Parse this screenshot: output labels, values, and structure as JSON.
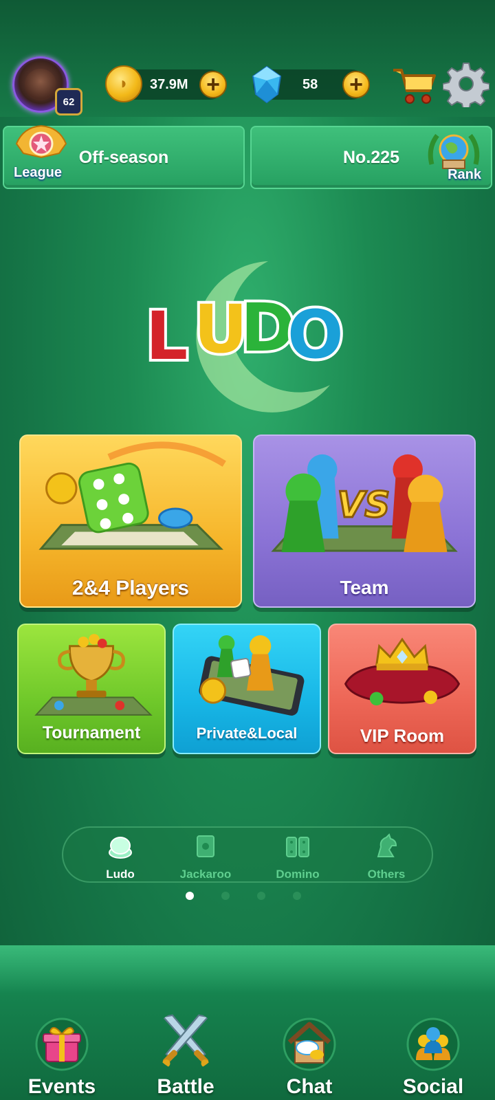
{
  "player": {
    "level": "62"
  },
  "currency": {
    "coins": "37.9M",
    "gems": "58",
    "add_symbol": "+"
  },
  "league": {
    "label": "League",
    "status": "Off-season"
  },
  "rank": {
    "label": "Rank",
    "position": "No.225"
  },
  "logo": {
    "letters": [
      "L",
      "U",
      "D",
      "O"
    ],
    "letter_colors": [
      "#d4232a",
      "#f3c21a",
      "#2bb33a",
      "#1aa0d8"
    ]
  },
  "modes": {
    "players": "2&4 Players",
    "team": "Team",
    "tournament": "Tournament",
    "private": "Private&Local",
    "vip": "VIP Room"
  },
  "game_tabs": [
    {
      "label": "Ludo",
      "active": true
    },
    {
      "label": "Jackaroo",
      "active": false
    },
    {
      "label": "Domino",
      "active": false
    },
    {
      "label": "Others",
      "active": false
    }
  ],
  "page_indicator": {
    "count": 4,
    "active_index": 0
  },
  "bottom_nav": {
    "events": "Events",
    "battle": "Battle",
    "chat": "Chat",
    "social": "Social",
    "active": "Battle"
  },
  "icons": {
    "cart": "shopping-cart-icon",
    "settings": "gear-icon",
    "coin": "coin-icon",
    "gem": "gem-icon"
  },
  "colors": {
    "background": "#1c8a52",
    "accent_gold": "#f5b81a",
    "tab_inactive": "#5fcf8f"
  }
}
